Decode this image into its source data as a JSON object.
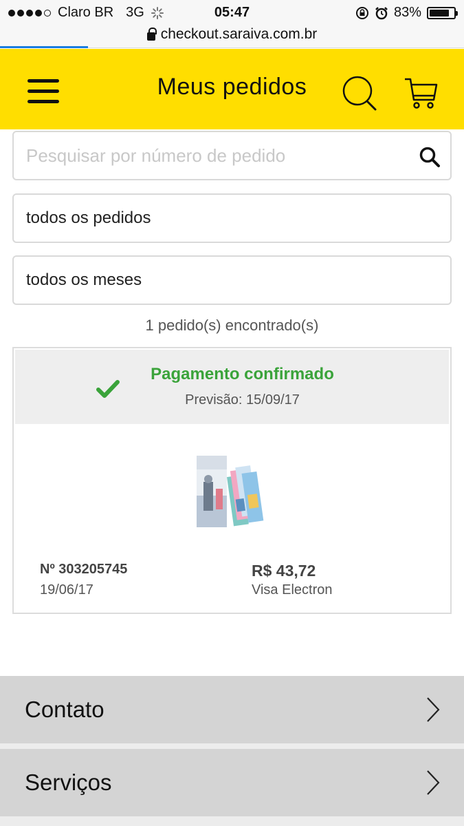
{
  "status_bar": {
    "carrier": "Claro BR",
    "network": "3G",
    "time": "05:47",
    "battery": "83%",
    "battery_level": 0.83
  },
  "url_bar": {
    "url": "checkout.saraiva.com.br",
    "load_progress": 0.19
  },
  "header": {
    "title": "Meus pedidos",
    "background_color": "#ffde00"
  },
  "filters": {
    "search_placeholder": "Pesquisar por número de pedido",
    "search_value": "",
    "orders_selected": "todos os pedidos",
    "months_selected": "todos os meses"
  },
  "results": {
    "count_text": "1 pedido(s) encontrado(s)"
  },
  "order": {
    "status": "Pagamento confirmado",
    "status_color": "#3aa33a",
    "forecast": "Previsão: 15/09/17",
    "number": "Nº 303205745",
    "date": "19/06/17",
    "price": "R$ 43,72",
    "payment_method": "Visa Electron"
  },
  "footer": {
    "items": [
      {
        "label": "Contato"
      },
      {
        "label": "Serviços"
      }
    ]
  }
}
